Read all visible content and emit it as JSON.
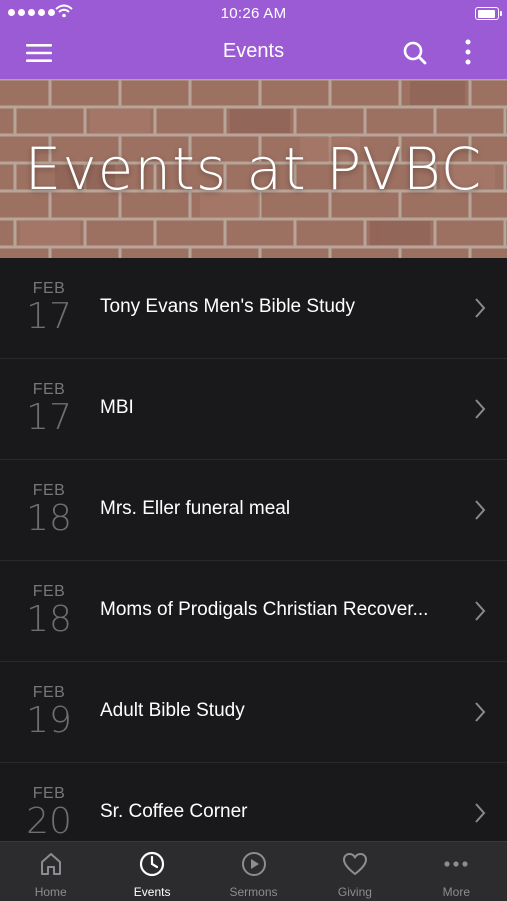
{
  "status_bar": {
    "time": "10:26 AM"
  },
  "header": {
    "title": "Events",
    "menu_icon": "hamburger-menu-icon",
    "search_icon": "search-icon",
    "more_icon": "vertical-dots-icon",
    "background_color": "#9b5bd4"
  },
  "banner": {
    "title": "Events at PVBC"
  },
  "events": [
    {
      "month": "FEB",
      "day": "17",
      "title": "Tony Evans Men's Bible Study"
    },
    {
      "month": "FEB",
      "day": "17",
      "title": "MBI"
    },
    {
      "month": "FEB",
      "day": "18",
      "title": "Mrs. Eller funeral meal"
    },
    {
      "month": "FEB",
      "day": "18",
      "title": "Moms of Prodigals Christian Recover..."
    },
    {
      "month": "FEB",
      "day": "19",
      "title": "Adult Bible Study"
    },
    {
      "month": "FEB",
      "day": "20",
      "title": "Sr. Coffee Corner"
    }
  ],
  "tabs": [
    {
      "label": "Home",
      "icon": "home-icon",
      "active": false
    },
    {
      "label": "Events",
      "icon": "clock-icon",
      "active": true
    },
    {
      "label": "Sermons",
      "icon": "play-circle-icon",
      "active": false
    },
    {
      "label": "Giving",
      "icon": "heart-icon",
      "active": false
    },
    {
      "label": "More",
      "icon": "horizontal-dots-icon",
      "active": false
    }
  ]
}
